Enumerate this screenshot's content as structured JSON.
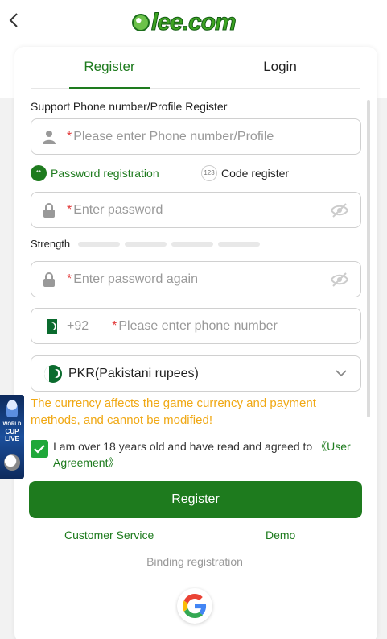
{
  "header": {
    "back_icon": "chevron-left-icon",
    "logo_text": "lee.com"
  },
  "tabs": [
    {
      "label": "Register",
      "active": true
    },
    {
      "label": "Login",
      "active": false
    }
  ],
  "form": {
    "section_label": "Support Phone number/Profile Register",
    "account_placeholder": "Please enter Phone number/Profile",
    "methods": {
      "password": "Password registration",
      "code": "Code register"
    },
    "password_placeholder": "Enter password",
    "strength_label": "Strength",
    "confirm_placeholder": "Enter password again",
    "phone_prefix": "+92",
    "phone_placeholder": "Please enter phone number",
    "currency": "PKR(Pakistani rupees)",
    "currency_warning": "The currency affects the game currency and payment methods, and cannot be modified!",
    "agreement_text": "I am over 18 years old and have read and agreed to ",
    "agreement_link": "《User Agreement》",
    "agreement_checked": true,
    "register_button": "Register",
    "customer_service": "Customer Service",
    "demo": "Demo",
    "binding_label": "Binding registration"
  },
  "banner": {
    "line1": "WORLD",
    "line2": "CUP",
    "line3": "LIVE"
  },
  "colors": {
    "primary": "#1e7b1e",
    "warning": "#f0a814",
    "required": "#e23b3b"
  }
}
